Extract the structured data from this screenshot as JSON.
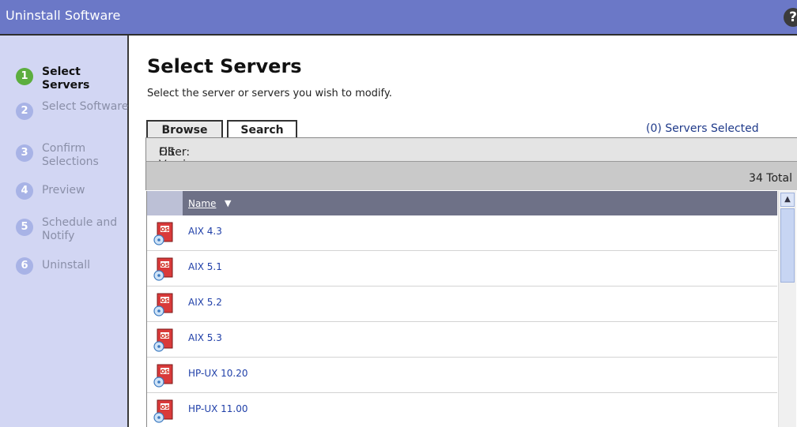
{
  "window": {
    "title": "Uninstall Software",
    "help_icon": "?"
  },
  "steps": [
    {
      "num": "1",
      "label": "Select Servers",
      "active": true
    },
    {
      "num": "2",
      "label": "Select Software",
      "active": false
    },
    {
      "num": "3",
      "label": "Confirm Selections",
      "active": false
    },
    {
      "num": "4",
      "label": "Preview",
      "active": false
    },
    {
      "num": "5",
      "label": "Schedule and Notify",
      "active": false
    },
    {
      "num": "6",
      "label": "Uninstall",
      "active": false
    }
  ],
  "main": {
    "title": "Select Servers",
    "subtitle": "Select the server or servers you wish to modify."
  },
  "tabs": {
    "browse": "Browse",
    "search": "Search"
  },
  "selection": {
    "count": "(0)",
    "label": "Servers Selected"
  },
  "filter": {
    "label": "Filter:",
    "value": "OS Version"
  },
  "total": {
    "text": "34 Total"
  },
  "grid": {
    "column_name": "Name",
    "sort_indicator": "▼",
    "row_icon": "os-icon",
    "rows": [
      "AIX 4.3",
      "AIX 5.1",
      "AIX 5.2",
      "AIX 5.3",
      "HP-UX 10.20",
      "HP-UX 11.00"
    ]
  },
  "colors": {
    "titlebar": "#6b78c7",
    "sidebar": "#d2d6f3",
    "active_step": "#5cae3e",
    "inactive_step": "#a8b3e6",
    "link": "#1f3fa8"
  }
}
